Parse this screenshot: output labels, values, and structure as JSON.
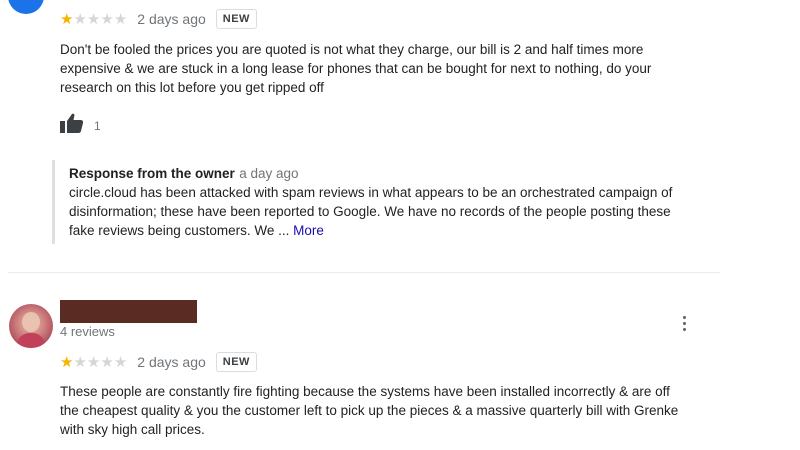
{
  "colors": {
    "star_filled": "#f4b400",
    "star_empty": "#d6d6d6",
    "link": "#1a0dab",
    "redaction": "#5a2b22"
  },
  "review_1": {
    "rating": 1,
    "max_rating": 5,
    "date": "2 days ago",
    "badge": "NEW",
    "text_lines": [
      "Don't be fooled the prices you are quoted is not what they charge, our bill is 2 and half times more",
      "expensive & we are stuck in a long lease for phones that can be bought for next to nothing, do your",
      "research on this lot before you get ripped off"
    ],
    "helpful_icon": "thumbs-up-icon",
    "helpful_count": "1",
    "owner_response": {
      "title": "Response from the owner",
      "time": "a day ago",
      "text_lines": [
        "circle.cloud has been attacked with spam reviews in what appears to be an orchestrated campaign of",
        "disinformation; these have been reported to Google. We have no records of the people posting these",
        "fake reviews being customers. We ..."
      ],
      "more_label": "More"
    }
  },
  "review_2": {
    "reviews_count": "4 reviews",
    "rating": 1,
    "max_rating": 5,
    "date": "2 days ago",
    "badge": "NEW",
    "menu_icon": "more-vert-icon",
    "text_lines": [
      "These people are constantly fire fighting because the systems have been installed incorrectly & are off",
      "the cheapest quality & you the customer left to pick up the pieces & a massive quarterly bill with Grenke",
      "with sky high call prices."
    ]
  }
}
